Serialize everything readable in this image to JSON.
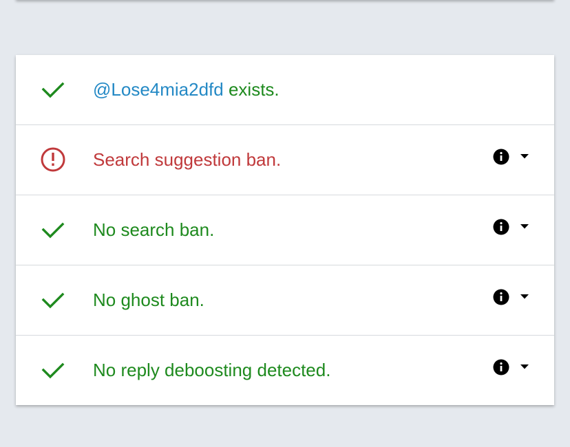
{
  "results": {
    "handle": "@Lose4mia2dfd",
    "rows": [
      {
        "status": "ok",
        "icon": "check-icon",
        "text": "exists.",
        "has_details": false
      },
      {
        "status": "error",
        "icon": "alert-circle-icon",
        "text": "Search suggestion ban.",
        "has_details": true
      },
      {
        "status": "ok",
        "icon": "check-icon",
        "text": "No search ban.",
        "has_details": true
      },
      {
        "status": "ok",
        "icon": "check-icon",
        "text": "No ghost ban.",
        "has_details": true
      },
      {
        "status": "ok",
        "icon": "check-icon",
        "text": "No reply deboosting detected.",
        "has_details": true
      }
    ]
  },
  "colors": {
    "ok": "#1e8a1e",
    "error": "#c0393b",
    "handle": "#2489c5",
    "background": "#e5e9ee"
  },
  "icons": {
    "details": "info-icon",
    "expand": "caret-down-icon"
  }
}
